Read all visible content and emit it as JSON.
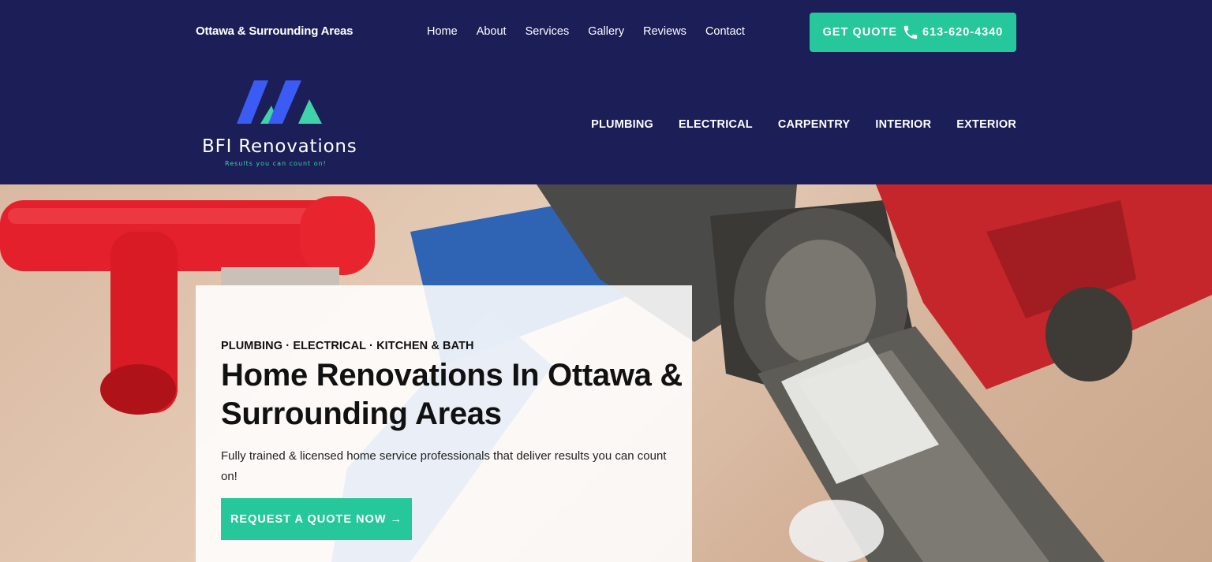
{
  "topbar": {
    "location": "Ottawa & Surrounding Areas",
    "nav": [
      "Home",
      "About",
      "Services",
      "Gallery",
      "Reviews",
      "Contact"
    ],
    "quote_label": "GET QUOTE",
    "phone_icon": "phone-icon",
    "phone": "613-620-4340"
  },
  "header": {
    "logo_name": "BFI Renovations",
    "logo_tagline": "Results you can count on!",
    "service_nav": [
      "PLUMBING",
      "ELECTRICAL",
      "CARPENTRY",
      "INTERIOR",
      "EXTERIOR"
    ]
  },
  "hero": {
    "eyebrow": "PLUMBING · ELECTRICAL · KITCHEN & BATH",
    "title": "Home Renovations In Ottawa & Surrounding Areas",
    "description": "Fully trained & licensed home service professionals that deliver results you can count on!",
    "cta_label": "REQUEST A QUOTE NOW →"
  },
  "colors": {
    "navy": "#1b1e57",
    "accent": "#26c79a"
  }
}
